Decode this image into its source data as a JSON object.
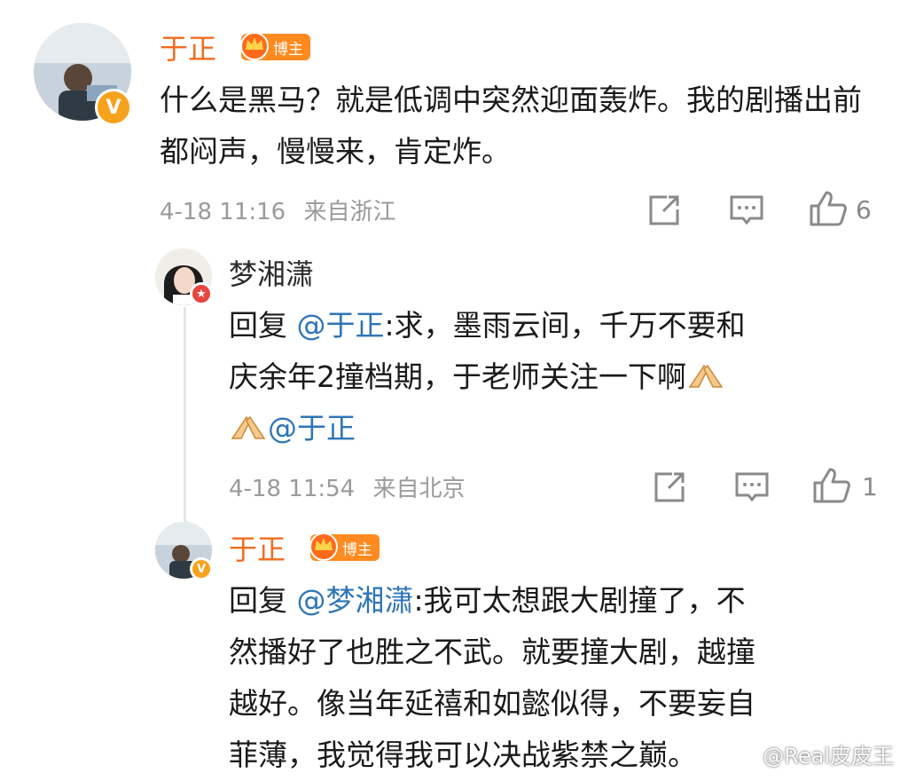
{
  "comment": {
    "user": "于正",
    "badge": "博主",
    "text": "什么是黑马？就是低调中突然迎面轰炸。我的剧播出前都闷声，慢慢来，肯定炸。",
    "time": "4-18 11:16",
    "location": "来自浙江",
    "likes": "6"
  },
  "reply1": {
    "user": "梦湘潇",
    "prefix": "回复 ",
    "mention": "@于正",
    "line1_rest": ":求，墨雨云间，千万不要和",
    "line2": "庆余年2撞档期，于老师关注一下啊",
    "mention2": "@于正",
    "time": "4-18 11:54",
    "location": "来自北京",
    "likes": "1"
  },
  "reply2": {
    "user": "于正",
    "badge": "博主",
    "prefix": "回复 ",
    "mention": "@梦湘潇",
    "line1_rest": ":我可太想跟大剧撞了，不",
    "line2": "然播好了也胜之不武。就要撞大剧，越撞",
    "line3": "越好。像当年延禧和如懿似得，不要妄自",
    "line4": "菲薄，我觉得我可以决战紫禁之巅。"
  },
  "watermark": "@Real皮皮王",
  "colors": {
    "orange_name": "#f26b1d",
    "mention_blue": "#2e75b6",
    "badge_bg": "#ff8a1f"
  },
  "icons": [
    "share-icon",
    "comment-icon",
    "like-icon",
    "pray-hands-emoji",
    "crown-icon",
    "verified-icon"
  ]
}
